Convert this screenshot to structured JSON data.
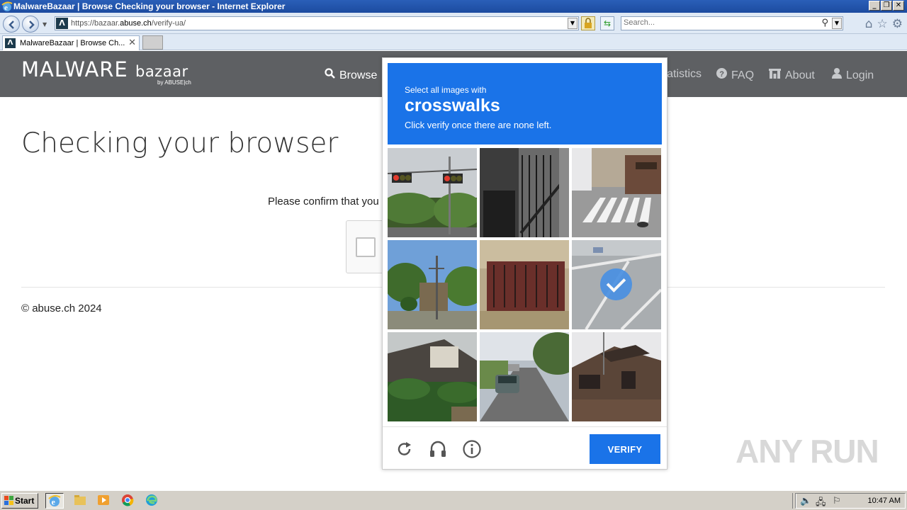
{
  "window": {
    "title": "MalwareBazaar | Browse Checking your browser - Internet Explorer",
    "controls": {
      "minimize": "_",
      "maximize": "❐",
      "close": "✕"
    }
  },
  "browser": {
    "url_scheme": "https://",
    "url_host_prefix": "bazaar.",
    "url_host": "abuse.ch",
    "url_path": "/verify-ua/",
    "search_placeholder": "Search...",
    "tab_title": "MalwareBazaar | Browse Ch...",
    "tab_close": "✕"
  },
  "site_nav": {
    "logo": "MALWARE",
    "logo_sub": "bazaar",
    "logo_by": "by ABUSE|ch",
    "links": [
      {
        "icon": "search-icon",
        "label": "Browse"
      },
      {
        "icon": "chart-icon",
        "label": "Statistics"
      },
      {
        "icon": "question-icon",
        "label": "FAQ"
      },
      {
        "icon": "building-icon",
        "label": "About"
      },
      {
        "icon": "user-icon",
        "label": "Login"
      }
    ]
  },
  "main": {
    "title": "Checking your browser",
    "confirm_text": "Please confirm that you",
    "footer": "© abuse.ch 2024"
  },
  "captcha": {
    "instruction": "Select all images with",
    "target": "crosswalks",
    "subtext": "Click verify once there are none left.",
    "verify_label": "VERIFY",
    "tiles": [
      {
        "subject": "traffic-lights",
        "selected": false
      },
      {
        "subject": "building-staircase",
        "selected": false
      },
      {
        "subject": "crosswalk-street",
        "selected": false
      },
      {
        "subject": "street-lamp-trees",
        "selected": false
      },
      {
        "subject": "balcony",
        "selected": false
      },
      {
        "subject": "road-markings",
        "selected": true
      },
      {
        "subject": "house-hedge",
        "selected": false
      },
      {
        "subject": "street-car",
        "selected": false
      },
      {
        "subject": "brown-house",
        "selected": false
      }
    ]
  },
  "watermark": "ANY RUN",
  "taskbar": {
    "start_label": "Start",
    "clock": "10:47 AM"
  }
}
